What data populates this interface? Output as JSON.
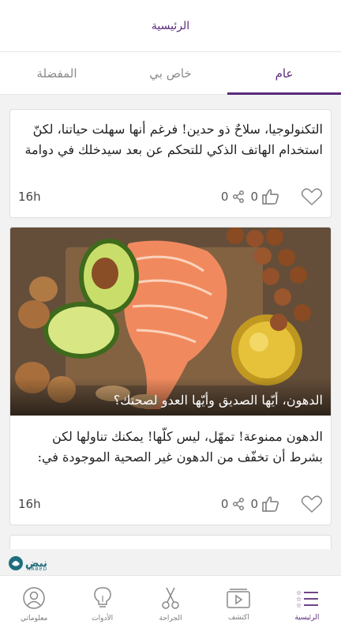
{
  "header": {
    "title": "الرئيسية"
  },
  "tabs": [
    {
      "label": "المفضلة"
    },
    {
      "label": "خاص بي"
    },
    {
      "label": "عام"
    }
  ],
  "posts": [
    {
      "text": "التكنولوجيا، سلاحٌ ذو حدين! فرغم أنها سهلت حياتنا، لكنّ استخدام الهاتف الذكي للتحكم عن بعد سيدخلك في دوامة خ…",
      "likes": "0",
      "shares": "0",
      "time": "16h"
    },
    {
      "image_caption": "الدهون، أيّها الصديق وأيّها العدو لصحتك؟",
      "text": "الدهون ممنوعة! تمهّل، ليس كلّها! يمكنك تناولها لكن بشرط أن تخفّف من الدهون غير الصحية الموجودة في:",
      "likes": "0",
      "shares": "0",
      "time": "16h"
    }
  ],
  "logo": {
    "arabic": "نبض",
    "latin": "NABED"
  },
  "bottom_nav": [
    {
      "label": "معلوماتي",
      "icon": "user-icon"
    },
    {
      "label": "الأدوات",
      "icon": "lightbulb-icon"
    },
    {
      "label": "الجراحة",
      "icon": "scissors-icon"
    },
    {
      "label": "اكتشف",
      "icon": "video-icon"
    },
    {
      "label": "الرئيسية",
      "icon": "home-list-icon"
    }
  ],
  "colors": {
    "accent": "#5b2a7a",
    "brand": "#1f6e7e"
  }
}
